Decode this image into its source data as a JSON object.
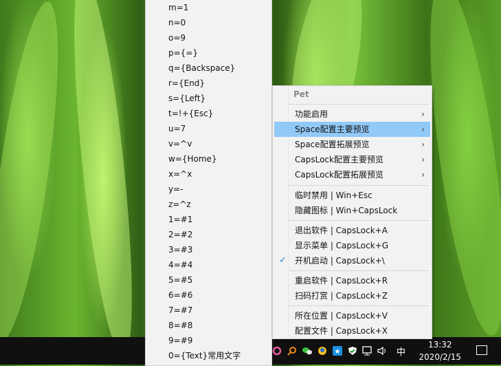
{
  "key_menu": {
    "items": [
      "m=1",
      "n=0",
      "o=9",
      "p={=}",
      "q={Backspace}",
      "r={End}",
      "s={Left}",
      "t=!+{Esc}",
      "u=7",
      "v=^v",
      "w={Home}",
      "x=^x",
      "y=-",
      "z=^z",
      "1=#1",
      "2=#2",
      "3=#3",
      "4=#4",
      "5=#5",
      "6=#6",
      "7=#7",
      "8=#8",
      "9=#9",
      "0={Text}常用文字"
    ]
  },
  "context_menu": {
    "title": "Pet",
    "items": [
      {
        "label": "功能启用",
        "submenu": true
      },
      {
        "label": "Space配置主要预览",
        "submenu": true,
        "highlighted": true
      },
      {
        "label": "Space配置拓展预览",
        "submenu": true
      },
      {
        "label": "CapsLock配置主要预览",
        "submenu": true
      },
      {
        "label": "CapsLock配置拓展预览",
        "submenu": true
      },
      {
        "label": "临时禁用 | Win+Esc"
      },
      {
        "label": "隐藏图标 | Win+CapsLock"
      },
      {
        "label": "退出软件 | CapsLock+A"
      },
      {
        "label": "显示菜单 | CapsLock+G"
      },
      {
        "label": "开机启动 | CapsLock+\\",
        "checked": true
      },
      {
        "label": "重启软件 | CapsLock+R"
      },
      {
        "label": "扫码打赏 | CapsLock+Z"
      },
      {
        "label": "所在位置 | CapsLock+V"
      },
      {
        "label": "配置文件 | CapsLock+X"
      }
    ],
    "arrow_glyph": "›",
    "check_glyph": "✓"
  },
  "taskbar": {
    "time": "13:32",
    "date": "2020/2/15",
    "ime": "中",
    "tray_icons": [
      "ring-icon",
      "search-icon",
      "wechat-icon",
      "chat-icon",
      "star-icon",
      "shield-icon",
      "network-icon",
      "volume-icon"
    ]
  },
  "colors": {
    "highlight": "#91c9f7",
    "menu_bg": "#f2f2f2",
    "taskbar": "#101010"
  }
}
